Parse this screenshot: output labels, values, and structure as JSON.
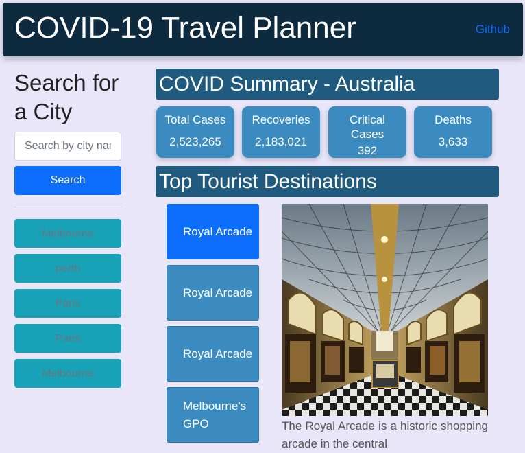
{
  "header": {
    "title": "COVID-19 Travel Planner",
    "github_label": "Github"
  },
  "sidebar": {
    "title": "Search for a City",
    "search_placeholder": "Search by city name",
    "search_button": "Search",
    "history": [
      "Melbourne",
      "perth",
      "Paris",
      "Paris",
      "Melbourne"
    ]
  },
  "summary": {
    "title": "COVID Summary - Australia",
    "stats": [
      {
        "label": "Total Cases",
        "value": "2,523,265"
      },
      {
        "label": "Recoveries",
        "value": "2,183,021"
      },
      {
        "label": "Critical Cases",
        "value": "392"
      },
      {
        "label": "Deaths",
        "value": "3,633"
      }
    ]
  },
  "destinations": {
    "title": "Top Tourist Destinations",
    "items": [
      "Royal Arcade",
      "Royal Arcade",
      "Royal Arcade",
      "Melbourne's GPO"
    ],
    "selected_index": 0,
    "description": "The Royal Arcade is a historic shopping arcade in the central"
  },
  "colors": {
    "header_bg": "#0e2a3e",
    "section_bg": "#205b7f",
    "card_bg": "#3b8bc0",
    "primary": "#0d6efd",
    "history_bg": "#17a2b8",
    "page_bg": "#e8e6f8"
  }
}
